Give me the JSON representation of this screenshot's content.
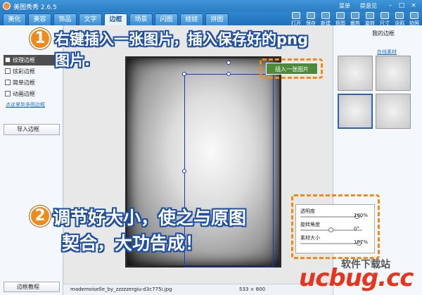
{
  "titlebar": {
    "app_title": "美图秀秀 2.6.5",
    "menu": "菜单",
    "feedback": "提意见"
  },
  "tabs": [
    "美化",
    "美容",
    "饰品",
    "文字",
    "边框",
    "场景",
    "闪图",
    "娃娃",
    "拼图"
  ],
  "active_tab": "边框",
  "toolbar": [
    "打开",
    "保存",
    "新建",
    "抠图",
    "裁剪",
    "旋转",
    "尺寸",
    "涂鸦",
    "拍照"
  ],
  "zoom_label": "1:1",
  "side_menu": [
    {
      "label": "纹理边框",
      "active": true
    },
    {
      "label": "炫彩边框",
      "active": false
    },
    {
      "label": "简单边框",
      "active": false
    },
    {
      "label": "动画边框",
      "active": false
    }
  ],
  "side_link": "点这里到多图边框",
  "import_button": "导入边框",
  "bottom_button": "边框教程",
  "right_panel": {
    "header": "我的边框",
    "link": "在线素材"
  },
  "insert_badge": "插入一张图片",
  "adjust": {
    "rows": [
      {
        "label": "透明度",
        "value": "100%",
        "level": 0.92
      },
      {
        "label": "旋转角度",
        "value": "0°",
        "level": 0.5
      },
      {
        "label": "素材大小",
        "value": "107%",
        "level": 0.95
      }
    ]
  },
  "status": {
    "filename": "mademoiselle_by_zzzzzergiu-d3c775i.jpg",
    "size": "533 × 800"
  },
  "annotation1": {
    "number": "1",
    "line1": "右键插入一张图片，插入保存好的png",
    "line2": "图片."
  },
  "annotation2": {
    "number": "2",
    "line1": "调节好大小，使之与原图",
    "line2": "契合，大功告成！"
  },
  "watermark": {
    "top": "软件下载站",
    "main": "ucbug.cc"
  },
  "colors": {
    "accent_orange": "#f08a1c",
    "text_outline_blue": "#1d4ea8",
    "watermark_red": "#e8341c"
  }
}
